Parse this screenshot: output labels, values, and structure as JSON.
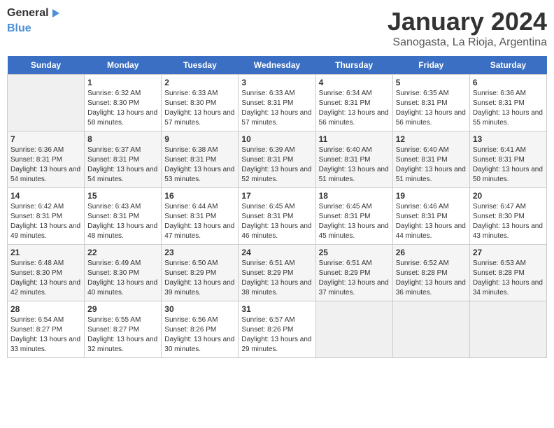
{
  "logo": {
    "text_general": "General",
    "text_blue": "Blue"
  },
  "title": "January 2024",
  "subtitle": "Sanogasta, La Rioja, Argentina",
  "header_days": [
    "Sunday",
    "Monday",
    "Tuesday",
    "Wednesday",
    "Thursday",
    "Friday",
    "Saturday"
  ],
  "weeks": [
    [
      {
        "num": "",
        "sunrise": "",
        "sunset": "",
        "daylight": ""
      },
      {
        "num": "1",
        "sunrise": "Sunrise: 6:32 AM",
        "sunset": "Sunset: 8:30 PM",
        "daylight": "Daylight: 13 hours and 58 minutes."
      },
      {
        "num": "2",
        "sunrise": "Sunrise: 6:33 AM",
        "sunset": "Sunset: 8:30 PM",
        "daylight": "Daylight: 13 hours and 57 minutes."
      },
      {
        "num": "3",
        "sunrise": "Sunrise: 6:33 AM",
        "sunset": "Sunset: 8:31 PM",
        "daylight": "Daylight: 13 hours and 57 minutes."
      },
      {
        "num": "4",
        "sunrise": "Sunrise: 6:34 AM",
        "sunset": "Sunset: 8:31 PM",
        "daylight": "Daylight: 13 hours and 56 minutes."
      },
      {
        "num": "5",
        "sunrise": "Sunrise: 6:35 AM",
        "sunset": "Sunset: 8:31 PM",
        "daylight": "Daylight: 13 hours and 56 minutes."
      },
      {
        "num": "6",
        "sunrise": "Sunrise: 6:36 AM",
        "sunset": "Sunset: 8:31 PM",
        "daylight": "Daylight: 13 hours and 55 minutes."
      }
    ],
    [
      {
        "num": "7",
        "sunrise": "Sunrise: 6:36 AM",
        "sunset": "Sunset: 8:31 PM",
        "daylight": "Daylight: 13 hours and 54 minutes."
      },
      {
        "num": "8",
        "sunrise": "Sunrise: 6:37 AM",
        "sunset": "Sunset: 8:31 PM",
        "daylight": "Daylight: 13 hours and 54 minutes."
      },
      {
        "num": "9",
        "sunrise": "Sunrise: 6:38 AM",
        "sunset": "Sunset: 8:31 PM",
        "daylight": "Daylight: 13 hours and 53 minutes."
      },
      {
        "num": "10",
        "sunrise": "Sunrise: 6:39 AM",
        "sunset": "Sunset: 8:31 PM",
        "daylight": "Daylight: 13 hours and 52 minutes."
      },
      {
        "num": "11",
        "sunrise": "Sunrise: 6:40 AM",
        "sunset": "Sunset: 8:31 PM",
        "daylight": "Daylight: 13 hours and 51 minutes."
      },
      {
        "num": "12",
        "sunrise": "Sunrise: 6:40 AM",
        "sunset": "Sunset: 8:31 PM",
        "daylight": "Daylight: 13 hours and 51 minutes."
      },
      {
        "num": "13",
        "sunrise": "Sunrise: 6:41 AM",
        "sunset": "Sunset: 8:31 PM",
        "daylight": "Daylight: 13 hours and 50 minutes."
      }
    ],
    [
      {
        "num": "14",
        "sunrise": "Sunrise: 6:42 AM",
        "sunset": "Sunset: 8:31 PM",
        "daylight": "Daylight: 13 hours and 49 minutes."
      },
      {
        "num": "15",
        "sunrise": "Sunrise: 6:43 AM",
        "sunset": "Sunset: 8:31 PM",
        "daylight": "Daylight: 13 hours and 48 minutes."
      },
      {
        "num": "16",
        "sunrise": "Sunrise: 6:44 AM",
        "sunset": "Sunset: 8:31 PM",
        "daylight": "Daylight: 13 hours and 47 minutes."
      },
      {
        "num": "17",
        "sunrise": "Sunrise: 6:45 AM",
        "sunset": "Sunset: 8:31 PM",
        "daylight": "Daylight: 13 hours and 46 minutes."
      },
      {
        "num": "18",
        "sunrise": "Sunrise: 6:45 AM",
        "sunset": "Sunset: 8:31 PM",
        "daylight": "Daylight: 13 hours and 45 minutes."
      },
      {
        "num": "19",
        "sunrise": "Sunrise: 6:46 AM",
        "sunset": "Sunset: 8:31 PM",
        "daylight": "Daylight: 13 hours and 44 minutes."
      },
      {
        "num": "20",
        "sunrise": "Sunrise: 6:47 AM",
        "sunset": "Sunset: 8:30 PM",
        "daylight": "Daylight: 13 hours and 43 minutes."
      }
    ],
    [
      {
        "num": "21",
        "sunrise": "Sunrise: 6:48 AM",
        "sunset": "Sunset: 8:30 PM",
        "daylight": "Daylight: 13 hours and 42 minutes."
      },
      {
        "num": "22",
        "sunrise": "Sunrise: 6:49 AM",
        "sunset": "Sunset: 8:30 PM",
        "daylight": "Daylight: 13 hours and 40 minutes."
      },
      {
        "num": "23",
        "sunrise": "Sunrise: 6:50 AM",
        "sunset": "Sunset: 8:29 PM",
        "daylight": "Daylight: 13 hours and 39 minutes."
      },
      {
        "num": "24",
        "sunrise": "Sunrise: 6:51 AM",
        "sunset": "Sunset: 8:29 PM",
        "daylight": "Daylight: 13 hours and 38 minutes."
      },
      {
        "num": "25",
        "sunrise": "Sunrise: 6:51 AM",
        "sunset": "Sunset: 8:29 PM",
        "daylight": "Daylight: 13 hours and 37 minutes."
      },
      {
        "num": "26",
        "sunrise": "Sunrise: 6:52 AM",
        "sunset": "Sunset: 8:28 PM",
        "daylight": "Daylight: 13 hours and 36 minutes."
      },
      {
        "num": "27",
        "sunrise": "Sunrise: 6:53 AM",
        "sunset": "Sunset: 8:28 PM",
        "daylight": "Daylight: 13 hours and 34 minutes."
      }
    ],
    [
      {
        "num": "28",
        "sunrise": "Sunrise: 6:54 AM",
        "sunset": "Sunset: 8:27 PM",
        "daylight": "Daylight: 13 hours and 33 minutes."
      },
      {
        "num": "29",
        "sunrise": "Sunrise: 6:55 AM",
        "sunset": "Sunset: 8:27 PM",
        "daylight": "Daylight: 13 hours and 32 minutes."
      },
      {
        "num": "30",
        "sunrise": "Sunrise: 6:56 AM",
        "sunset": "Sunset: 8:26 PM",
        "daylight": "Daylight: 13 hours and 30 minutes."
      },
      {
        "num": "31",
        "sunrise": "Sunrise: 6:57 AM",
        "sunset": "Sunset: 8:26 PM",
        "daylight": "Daylight: 13 hours and 29 minutes."
      },
      {
        "num": "",
        "sunrise": "",
        "sunset": "",
        "daylight": ""
      },
      {
        "num": "",
        "sunrise": "",
        "sunset": "",
        "daylight": ""
      },
      {
        "num": "",
        "sunrise": "",
        "sunset": "",
        "daylight": ""
      }
    ]
  ]
}
